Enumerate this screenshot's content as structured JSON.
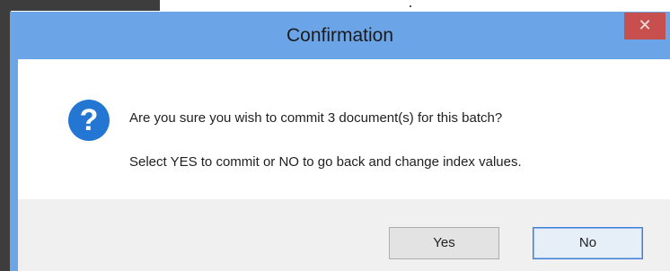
{
  "dialog": {
    "title": "Confirmation",
    "close_glyph": "✕",
    "icon": "question-icon",
    "icon_glyph": "?",
    "message_line1": "Are you sure you wish to commit 3 document(s) for this batch?",
    "message_line2": "Select YES to commit or NO to go back and change index values.",
    "buttons": {
      "yes_label": "Yes",
      "no_label": "No"
    }
  },
  "colors": {
    "titlebar": "#6ba5e8",
    "close_button": "#c7504f",
    "question_icon": "#2376d1",
    "footer": "#f0f0f0"
  }
}
